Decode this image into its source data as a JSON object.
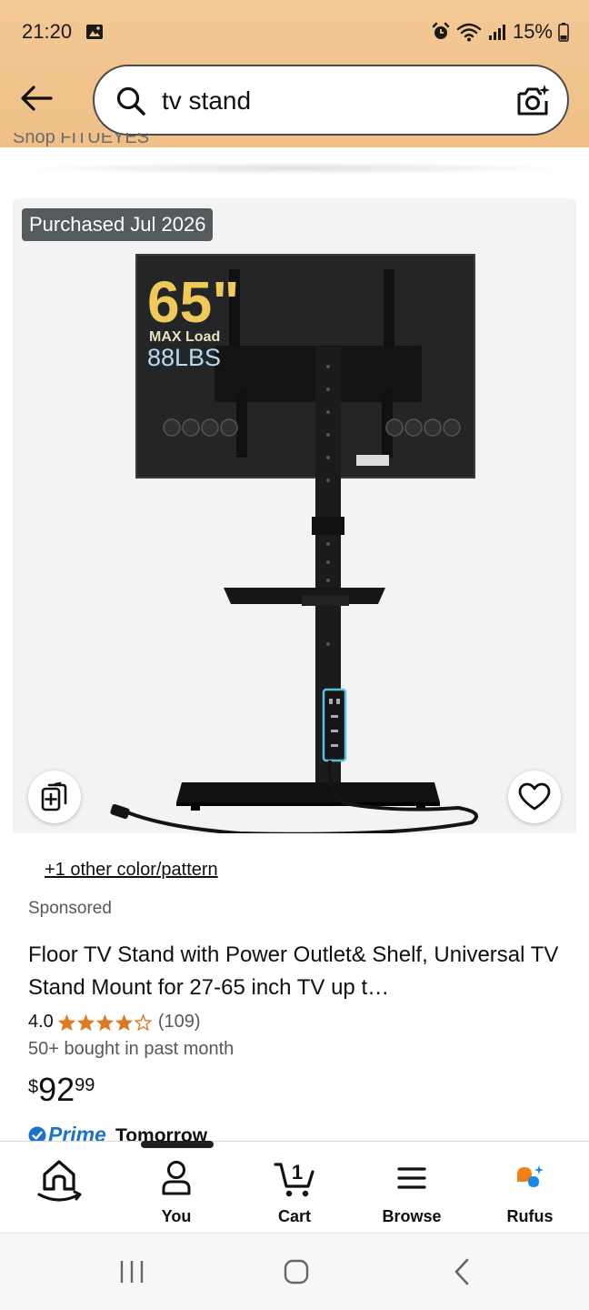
{
  "status_bar": {
    "time": "21:20",
    "battery": "15%",
    "icons": [
      "image-icon",
      "alarm-icon",
      "wifi-icon",
      "signal-icon",
      "battery-icon"
    ]
  },
  "search": {
    "query": "tv stand",
    "icons": [
      "back-arrow-icon",
      "search-icon",
      "camera-search-icon"
    ]
  },
  "clipped_text": "Shop FITUEYES",
  "product": {
    "purchased_badge": "Purchased Jul 2026",
    "image_overlay": {
      "size": "65\"",
      "load_label": "MAX Load",
      "weight": "88LBS"
    },
    "other_color": "+1 other color/pattern",
    "sponsored": "Sponsored",
    "title": "Floor TV Stand with Power Outlet& Shelf, Universal TV Stand Mount for 27-65 inch TV up t…",
    "rating": "4.0",
    "rating_value": 4.0,
    "rating_max": 5,
    "review_count": "(109)",
    "bought": "50+ bought in past month",
    "price_symbol": "$",
    "price_whole": "92",
    "price_fraction": "99",
    "prime_label": "Prime",
    "delivery": "Tomorrow"
  },
  "bottom_nav": {
    "items": [
      {
        "label": "",
        "icon": "home-icon"
      },
      {
        "label": "You",
        "icon": "user-icon"
      },
      {
        "label": "Cart",
        "icon": "cart-icon",
        "badge": "1"
      },
      {
        "label": "Browse",
        "icon": "menu-icon"
      },
      {
        "label": "Rufus",
        "icon": "rufus-icon"
      }
    ]
  },
  "colors": {
    "header_bg": "#f2c894",
    "star": "#de7921",
    "prime_blue": "#1a73c9",
    "rufus_orange": "#f27f1b",
    "rufus_blue": "#1e88e5"
  }
}
